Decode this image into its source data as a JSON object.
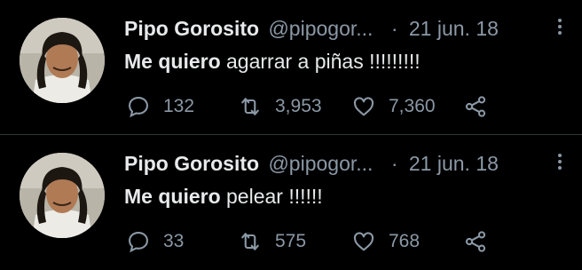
{
  "tweets": [
    {
      "author_name": "Pipo Gorosito",
      "handle": "@pipogor...",
      "separator": "·",
      "date": "21 jun. 18",
      "text_bold": "Me quiero",
      "text_rest": " agarrar a piñas !!!!!!!!!",
      "replies": "132",
      "retweets": "3,953",
      "likes": "7,360",
      "avatar_icon": "user-avatar"
    },
    {
      "author_name": "Pipo Gorosito",
      "handle": "@pipogor...",
      "separator": "·",
      "date": "21 jun. 18",
      "text_bold": "Me quiero",
      "text_rest": " pelear !!!!!!",
      "replies": "33",
      "retweets": "575",
      "likes": "768",
      "avatar_icon": "user-avatar"
    }
  ],
  "colors": {
    "background": "#000000",
    "primary_text": "#e7e9ea",
    "secondary_text": "#8b98a5",
    "divider": "#2f3336"
  }
}
